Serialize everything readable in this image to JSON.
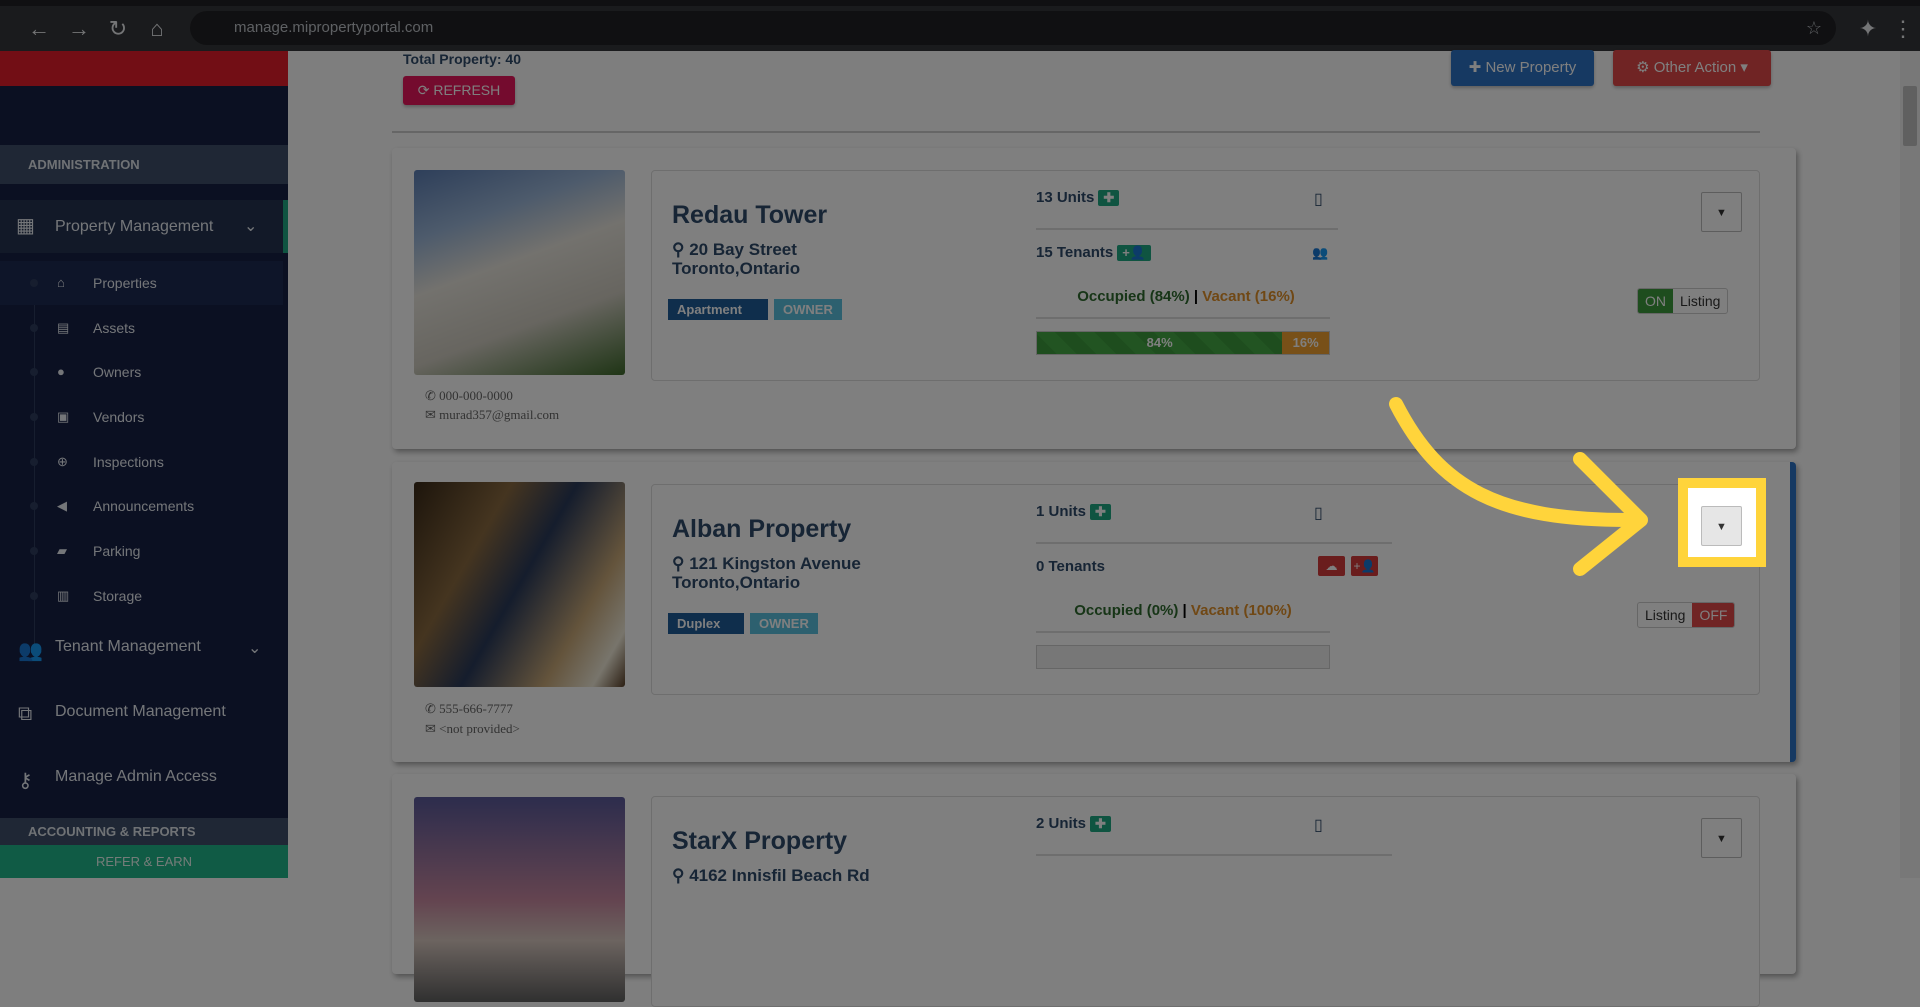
{
  "browser": {
    "url": "manage.mipropertyportal.com"
  },
  "sidebar": {
    "section_admin": "ADMINISTRATION",
    "property_management": "Property Management",
    "sub_items": [
      {
        "label": "Properties",
        "icon": "home-icon"
      },
      {
        "label": "Assets",
        "icon": "archive-icon"
      },
      {
        "label": "Owners",
        "icon": "user-icon"
      },
      {
        "label": "Vendors",
        "icon": "briefcase-icon"
      },
      {
        "label": "Inspections",
        "icon": "search-plus-icon"
      },
      {
        "label": "Announcements",
        "icon": "bullhorn-icon"
      },
      {
        "label": "Parking",
        "icon": "car-icon"
      },
      {
        "label": "Storage",
        "icon": "basket-icon"
      }
    ],
    "tenant_management": "Tenant Management",
    "document_management": "Document Management",
    "manage_admin_access": "Manage Admin Access",
    "section_accounting": "ACCOUNTING & REPORTS",
    "refer": "REFER & EARN"
  },
  "header": {
    "total": "Total Property: 40",
    "refresh": "REFRESH",
    "new_property": "New Property",
    "other_action": "Other Action"
  },
  "properties": [
    {
      "name": "Redau Tower",
      "street": "20 Bay Street",
      "city": "Toronto,Ontario",
      "type": "Apartment",
      "role": "OWNER",
      "units": "13 Units",
      "tenants": "15 Tenants",
      "occupied": "Occupied (84%)",
      "vacant": "Vacant (16%)",
      "occupied_pct": 84,
      "vacant_pct": 16,
      "occ_label": "84%",
      "vac_label": "16%",
      "listing": "Listing",
      "listing_state": "ON",
      "phone": "000-000-0000",
      "email": "murad357@gmail.com"
    },
    {
      "name": "Alban Property",
      "street": "121 Kingston Avenue",
      "city": "Toronto,Ontario",
      "type": "Duplex",
      "role": "OWNER",
      "units": "1 Units",
      "tenants": "0 Tenants",
      "occupied": "Occupied (0%)",
      "vacant": "Vacant (100%)",
      "occupied_pct": 0,
      "vacant_pct": 0,
      "listing": "Listing",
      "listing_state": "OFF",
      "phone": "555-666-7777",
      "email": "<not provided>"
    },
    {
      "name": "StarX Property",
      "street": "4162 Innisfil Beach Rd",
      "units": "2 Units"
    }
  ],
  "colors": {
    "highlight": "#ffd43b",
    "primary": "#1f5c99",
    "danger": "#c9302c",
    "success": "#3c9a3c",
    "warning": "#f0a030"
  }
}
